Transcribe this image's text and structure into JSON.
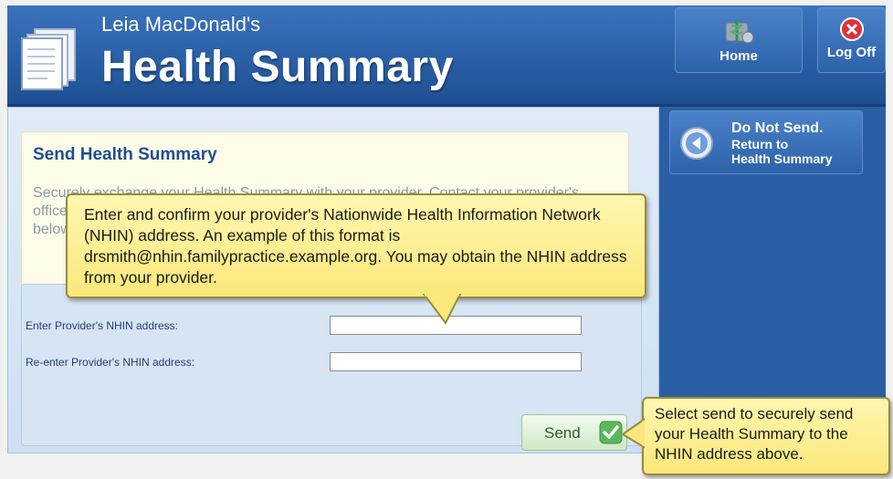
{
  "header": {
    "owner": "Leia MacDonald's",
    "title": "Health Summary",
    "home_label": "Home",
    "logoff_label": "Log Off"
  },
  "main": {
    "title": "Send Health Summary",
    "intro_text": "Securely exchange your Health Summary with your provider. Contact your provider's office to obtain their Nationwide Health Information Network (NHIN) address and enter it below.",
    "form": {
      "field1_label": "Enter Provider's NHIN address:",
      "field1_value": "",
      "field2_label": "Re-enter Provider's NHIN address:",
      "field2_value": ""
    },
    "send_label": "Send"
  },
  "sidebar": {
    "no_send_line1": "Do Not Send.",
    "no_send_line2": "Return to",
    "no_send_line3": "Health Summary"
  },
  "callouts": {
    "nhin_help": "Enter and confirm your provider's Nationwide Health Information Network (NHIN) address.  An example of this format is drsmith@nhin.familypractice.example.org.  You may obtain the NHIN address from your provider.",
    "send_help": "Select send to securely send your Health Summary to the NHIN address above."
  },
  "colors": {
    "header_blue": "#2a5fa6",
    "panel_bg": "#d6e4f3",
    "callout_yellow": "#fbe77a",
    "send_green": "#5cb85c"
  }
}
